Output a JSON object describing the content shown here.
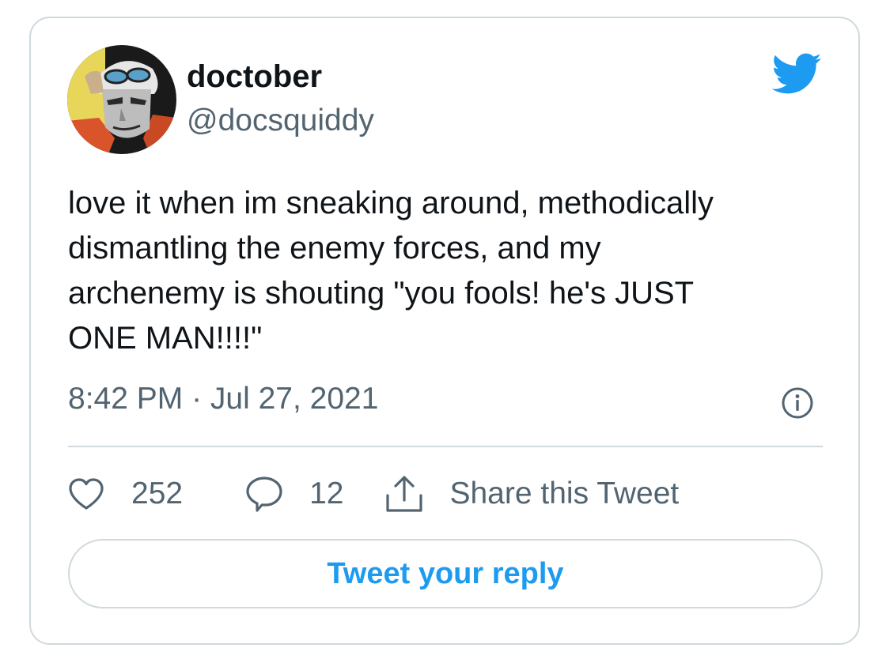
{
  "author": {
    "display_name": "doctober",
    "handle": "@docsquiddy"
  },
  "tweet": {
    "text": "love it when im sneaking around, methodically\ndismantling the enemy forces, and my\narchenemy is shouting \"you fools! he's JUST\nONE MAN!!!!\"",
    "timestamp": "8:42 PM · Jul 27, 2021"
  },
  "actions": {
    "likes": "252",
    "replies": "12",
    "share_label": "Share this Tweet"
  },
  "reply_button": {
    "label": "Tweet your reply"
  },
  "icons": {
    "brand": "twitter-bird-icon",
    "info": "info-icon",
    "like": "heart-icon",
    "reply": "speech-bubble-icon",
    "share": "share-upload-icon"
  },
  "colors": {
    "brand_blue": "#1d9bf0",
    "text_primary": "#0f1419",
    "text_secondary": "#536471",
    "border": "#cfd9de"
  }
}
